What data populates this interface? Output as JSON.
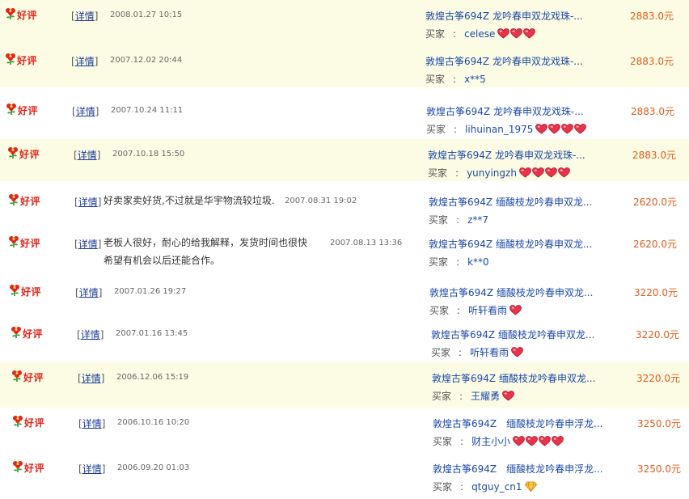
{
  "rating_label": "好评",
  "detail_label": "详情",
  "buyer_label": "买家",
  "buyer_sep": ":",
  "rows": [
    {
      "time": "2008.01.27 10:15",
      "comment": "",
      "comment_line2": "",
      "item": "敦煌古筝694Z 龙吟春申双龙戏珠-...",
      "buyer": "celese",
      "hearts": 3,
      "diamond": false,
      "price": "2883.0元",
      "shaded": true
    },
    {
      "time": "2007.12.02 20:44",
      "comment": "",
      "comment_line2": "",
      "item": "敦煌古筝694Z 龙吟春申双龙戏珠-...",
      "buyer": "x**5",
      "hearts": 0,
      "diamond": false,
      "price": "2883.0元",
      "shaded": true
    },
    {
      "time": "2007.10.24 11:11",
      "comment": "",
      "comment_line2": "",
      "item": "敦煌古筝694Z 龙吟春申双龙戏珠-...",
      "buyer": "lihuinan_1975",
      "hearts": 4,
      "diamond": false,
      "price": "2883.0元",
      "shaded": false
    },
    {
      "time": "2007.10.18 15:50",
      "comment": "",
      "comment_line2": "",
      "item": "敦煌古筝694Z 龙吟春申双龙戏珠-...",
      "buyer": "yunyingzh",
      "hearts": 4,
      "diamond": false,
      "price": "2883.0元",
      "shaded": true
    },
    {
      "time": "2007.08.31 19:02",
      "comment": "好卖家卖好货,不过就是华宇物流较垃圾.",
      "comment_line2": "",
      "item": "敦煌古筝694Z 缅酸枝龙吟春申双龙...",
      "buyer": "z**7",
      "hearts": 0,
      "diamond": false,
      "price": "2620.0元",
      "shaded": false
    },
    {
      "time": "2007.08.13 13:36",
      "comment": "老板人很好，耐心的给我解释，发货时间也很快",
      "comment_line2": "希望有机会以后还能合作。",
      "item": "敦煌古筝694Z 缅酸枝龙吟春申双龙...",
      "buyer": "k**0",
      "hearts": 0,
      "diamond": false,
      "price": "2620.0元",
      "shaded": false
    },
    {
      "time": "2007.01.26 19:27",
      "comment": "",
      "comment_line2": "",
      "item": "敦煌古筝694Z 缅酸枝龙吟春申双龙...",
      "buyer": "听轩看雨",
      "hearts": 1,
      "diamond": false,
      "price": "3220.0元",
      "shaded": false
    },
    {
      "time": "2007.01.16 13:45",
      "comment": "",
      "comment_line2": "",
      "item": "敦煌古筝694Z 缅酸枝龙吟春申双龙...",
      "buyer": "听轩看雨",
      "hearts": 1,
      "diamond": false,
      "price": "3220.0元",
      "shaded": false
    },
    {
      "time": "2006.12.06 15:19",
      "comment": "",
      "comment_line2": "",
      "item": "敦煌古筝694Z 缅酸枝龙吟春申双龙...",
      "buyer": "王耀勇",
      "hearts": 1,
      "diamond": false,
      "price": "3220.0元",
      "shaded": true
    },
    {
      "time": "2006.10.16 10:20",
      "comment": "",
      "comment_line2": "",
      "item": "敦煌古筝694Z　缅酸枝龙吟春申浮龙...",
      "buyer": "财主小小",
      "hearts": 4,
      "diamond": false,
      "price": "3250.0元",
      "shaded": false
    },
    {
      "time": "2006.09.20 01:03",
      "comment": "",
      "comment_line2": "",
      "item": "敦煌古筝694Z　缅酸枝龙吟春申浮龙...",
      "buyer": "qtguy_cn1",
      "hearts": 0,
      "diamond": true,
      "price": "3250.0元",
      "shaded": false
    }
  ]
}
